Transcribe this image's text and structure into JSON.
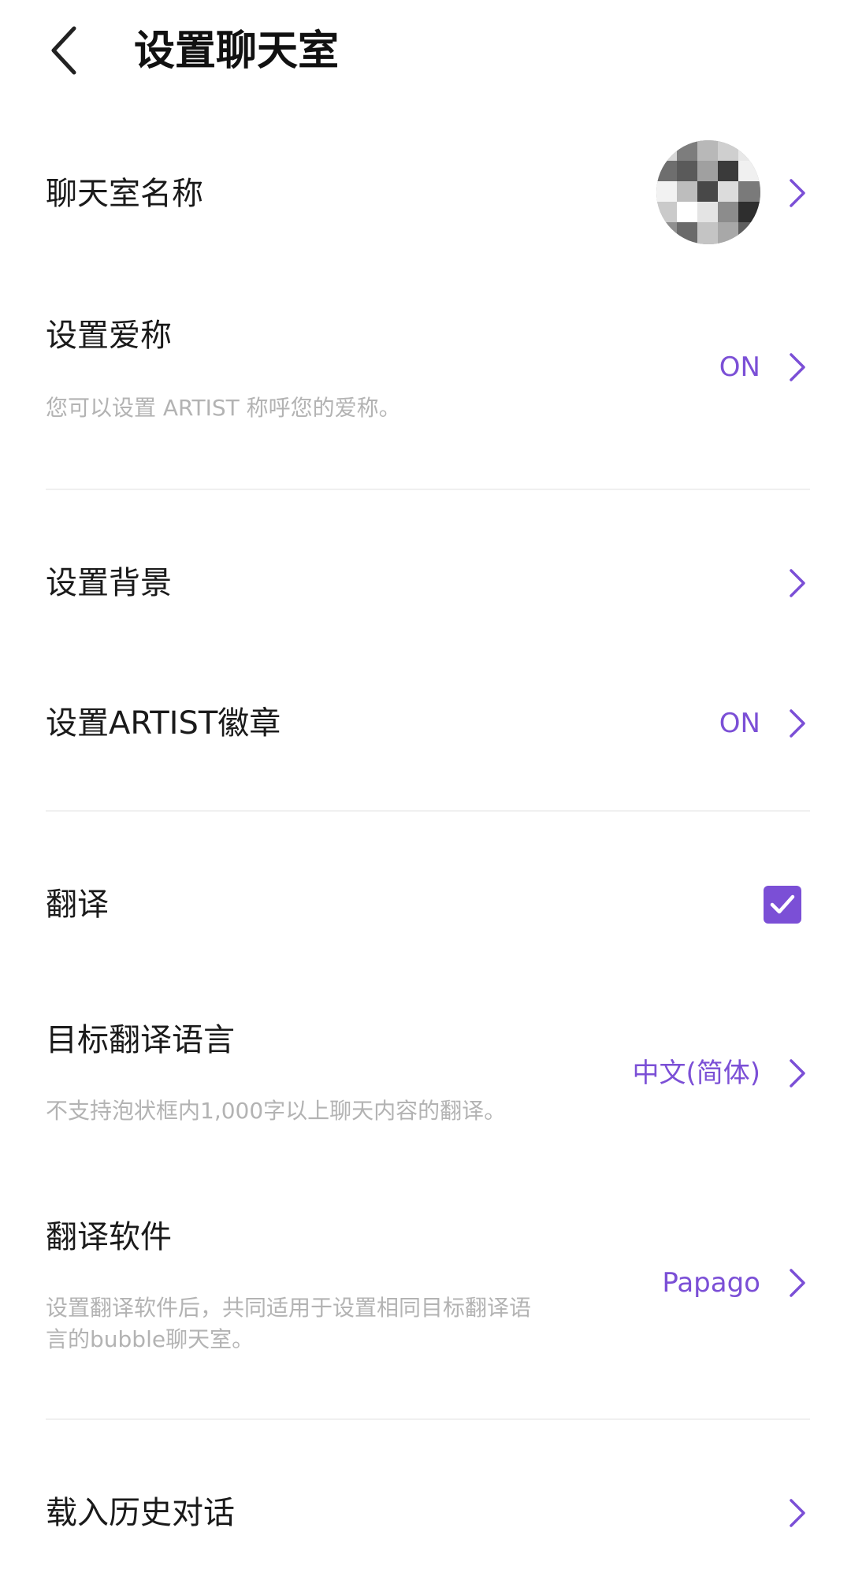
{
  "header": {
    "title": "设置聊天室"
  },
  "rows": {
    "room_name": {
      "title": "聊天室名称"
    },
    "nickname": {
      "title": "设置爱称",
      "subtitle": "您可以设置 ARTIST 称呼您的爱称。",
      "value": "ON"
    },
    "background": {
      "title": "设置背景"
    },
    "badge": {
      "title": "设置ARTIST徽章",
      "value": "ON"
    },
    "translate": {
      "title": "翻译",
      "checked": true
    },
    "target_lang": {
      "title": "目标翻译语言",
      "subtitle": "不支持泡状框内1,000字以上聊天内容的翻译。",
      "value": "中文(简体)"
    },
    "translator": {
      "title": "翻译软件",
      "subtitle_line1": "设置翻译软件后，共同适用于设置相同目标翻译语",
      "subtitle_line2": "言的bubble聊天室。",
      "value": "Papago"
    },
    "history": {
      "title": "载入历史对话"
    }
  },
  "colors": {
    "accent": "#7b4fd6",
    "subtext": "#b3b3b3"
  },
  "icons": {
    "back": "chevron-left-icon",
    "chevron": "chevron-right-icon",
    "check": "check-icon"
  }
}
